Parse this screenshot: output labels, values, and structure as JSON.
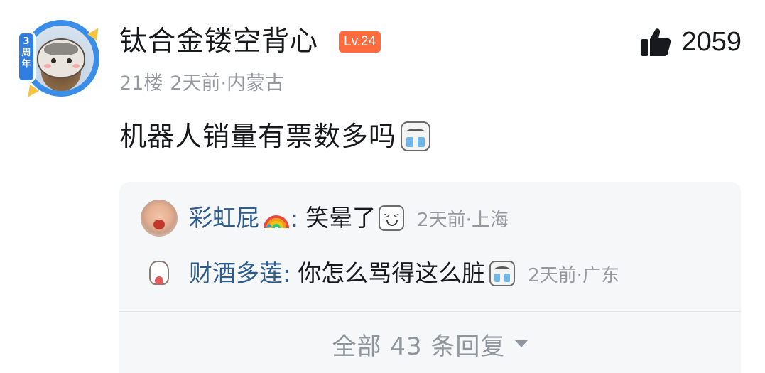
{
  "comment": {
    "user": {
      "name": "钛合金镂空背心",
      "level": "Lv.24",
      "anniversary_badge": "3周年"
    },
    "likes": "2059",
    "floor": "21楼",
    "time": "2天前",
    "separator": "·",
    "location": "内蒙古",
    "text": "机器人销量有票数多吗",
    "text_emoji": "cry-laugh-emoji"
  },
  "replies": [
    {
      "name": "彩虹屁",
      "name_emoji": "rainbow-icon",
      "colon": ":",
      "text": "笑晕了",
      "text_emoji": "laugh-emoji",
      "time": "2天前",
      "separator": "·",
      "location": "上海"
    },
    {
      "name": "财酒多莲",
      "colon": ":",
      "text": "你怎么骂得这么脏",
      "text_emoji": "cry-laugh-emoji",
      "time": "2天前",
      "separator": "·",
      "location": "广东"
    }
  ],
  "view_all": {
    "label": "全部 43 条回复",
    "icon": "caret-down-icon"
  },
  "colors": {
    "username_link": "#2d5c8e",
    "meta_gray": "#9499a0",
    "level_badge": "#ff6b3d",
    "reply_bg": "#f6f7f8",
    "ring_blue": "#3b8ee8"
  }
}
